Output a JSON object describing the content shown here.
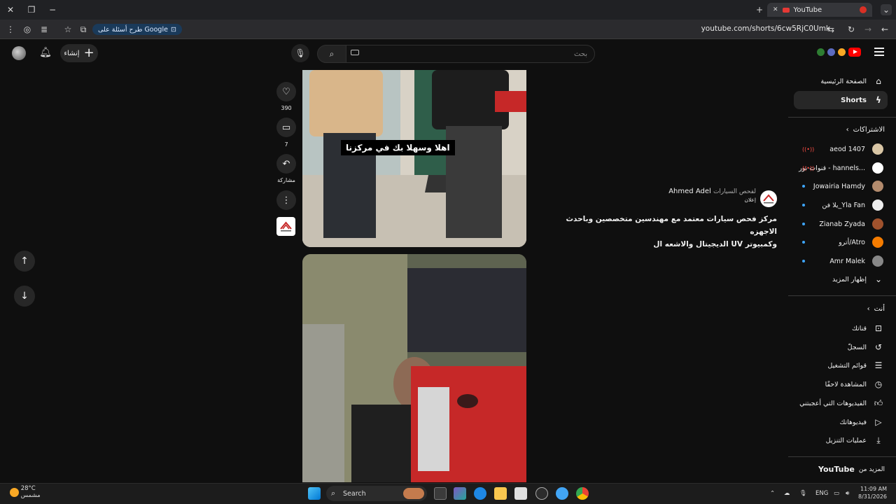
{
  "browser": {
    "tab_title": "YouTube",
    "url": "youtube.com/shorts/6cw5RjC0Umk",
    "google_badge": "طرح أسئلة على Google"
  },
  "header": {
    "search_placeholder": "بحث",
    "create_label": "إنشاء"
  },
  "sidebar": {
    "nav": [
      {
        "label": "الصفحة الرئيسية",
        "icon": "home-icon"
      },
      {
        "label": "Shorts",
        "icon": "shorts-icon"
      }
    ],
    "subscriptions_header": "الاشتراكات",
    "subscriptions": [
      {
        "name": "aeod 1407",
        "color": "#d9c6a5",
        "status": "live"
      },
      {
        "name": "قنوات نور - hannels...",
        "color": "#ffffff",
        "status": "live"
      },
      {
        "name": "Jowairia Hamdy",
        "color": "#b38b6d",
        "status": "new"
      },
      {
        "name": "يلا فن_Yla Fan",
        "color": "#eeeeee",
        "status": "new"
      },
      {
        "name": "Zianab Zyada",
        "color": "#a0522d",
        "status": "new"
      },
      {
        "name": "أترو/Atro",
        "color": "#f57c00",
        "status": "new"
      },
      {
        "name": "Amr Malek",
        "color": "#888888",
        "status": "new"
      }
    ],
    "show_more": "إظهار المزيد",
    "you_header": "أنت",
    "you_items": [
      {
        "label": "قناتك",
        "icon": "channel-icon"
      },
      {
        "label": "السجلّ",
        "icon": "history-icon"
      },
      {
        "label": "قوائم التشغيل",
        "icon": "playlist-icon"
      },
      {
        "label": "المشاهدة لاحقًا",
        "icon": "watch-later-icon"
      },
      {
        "label": "الفيديوهات التي أعجبتني",
        "icon": "like-icon"
      },
      {
        "label": "فيديوهاتك",
        "icon": "your-videos-icon"
      },
      {
        "label": "عمليات التنزيل",
        "icon": "download-icon"
      }
    ],
    "more_from_prefix": "المزيد من",
    "more_from_brand": "YouTube"
  },
  "short": {
    "caption": "اهلا وسهلا بك في مركزنا",
    "likes": "390",
    "comments": "7",
    "share_label": "مشاركة",
    "channel_name": "Ahmed Adel",
    "channel_sub": "لفحص السيارات",
    "ad_label": "إعلان",
    "title_line1": "مركز فحص سيارات معتمد مع مهندسين متخصصين وباحدث الاجهزه",
    "title_line2": "الديجيتال والاشعه ال UV وكمبيوتر"
  },
  "taskbar": {
    "temperature": "28°C",
    "weather_desc": "مشمس",
    "search_label": "Search",
    "language": "ENG",
    "time": "11:09 AM",
    "date": "8/31/2026"
  }
}
